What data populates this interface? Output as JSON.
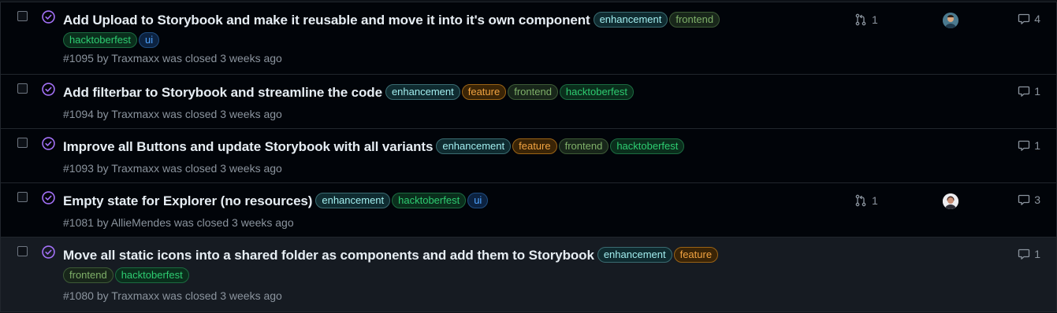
{
  "issues": [
    {
      "title": "Add Upload to Storybook and make it reusable and move it into it's own component",
      "labels": [
        "enhancement",
        "frontend",
        "hacktoberfest",
        "ui"
      ],
      "meta": "#1095 by Traxmaxx was closed 3 weeks ago",
      "linked_prs": "1",
      "has_avatar": true,
      "comments": "4"
    },
    {
      "title": "Add filterbar to Storybook and streamline the code",
      "labels": [
        "enhancement",
        "feature",
        "frontend",
        "hacktoberfest"
      ],
      "meta": "#1094 by Traxmaxx was closed 3 weeks ago",
      "comments": "1"
    },
    {
      "title": "Improve all Buttons and update Storybook with all variants",
      "labels": [
        "enhancement",
        "feature",
        "frontend",
        "hacktoberfest"
      ],
      "meta": "#1093 by Traxmaxx was closed 3 weeks ago",
      "comments": "1"
    },
    {
      "title": "Empty state for Explorer (no resources)",
      "labels": [
        "enhancement",
        "hacktoberfest",
        "ui"
      ],
      "meta": "#1081 by AllieMendes was closed 3 weeks ago",
      "linked_prs": "1",
      "has_avatar": true,
      "comments": "3"
    },
    {
      "title": "Move all static icons into a shared folder as components and add them to Storybook",
      "labels": [
        "enhancement",
        "feature",
        "frontend",
        "hacktoberfest"
      ],
      "meta": "#1080 by Traxmaxx was closed 3 weeks ago",
      "comments": "1"
    }
  ],
  "colors": {
    "closed_icon": "#a371f7",
    "background": "#010409"
  }
}
